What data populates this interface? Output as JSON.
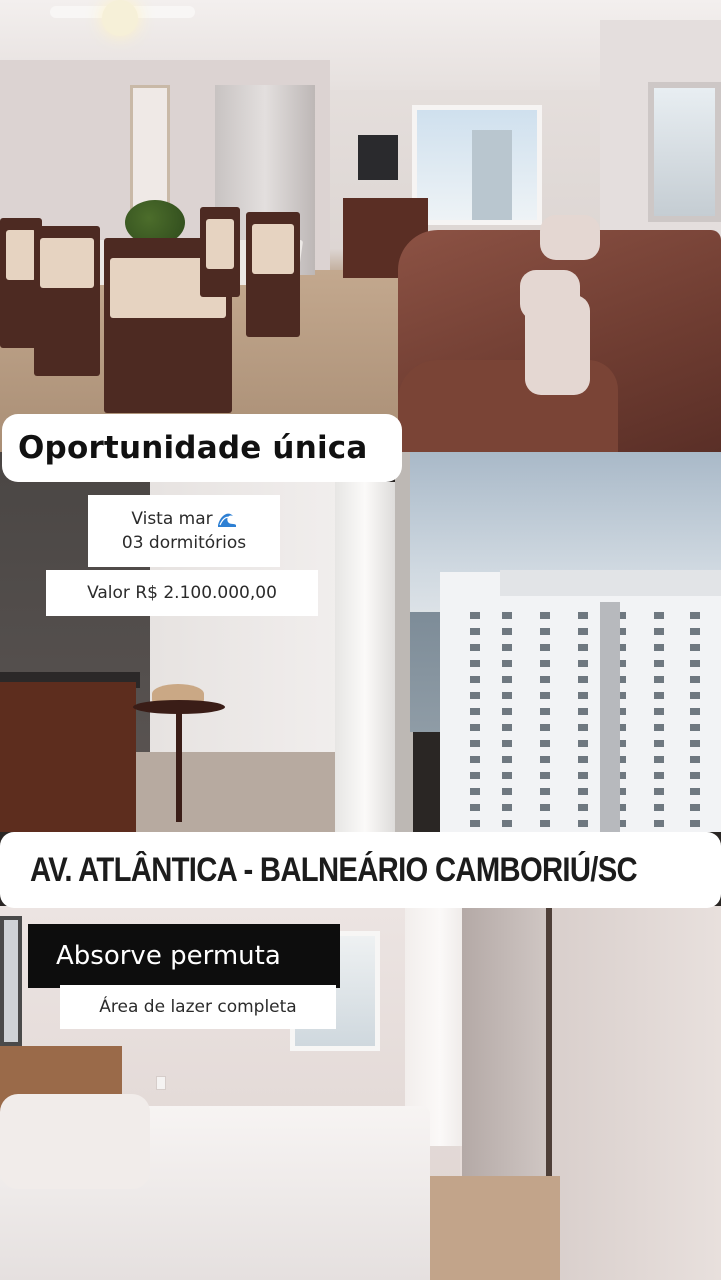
{
  "headline": "Oportunidade única",
  "features": {
    "sea_view": "Vista mar",
    "sea_view_icon": "wave-icon",
    "bedrooms": "03 dormitórios"
  },
  "price": "Valor R$ 2.100.000,00",
  "address": {
    "icon": "location-pin-icon",
    "text": "AV. ATLÂNTICA - BALNEÁRIO CAMBORIÚ/SC"
  },
  "trade": "Absorve permuta",
  "leisure": "Área de lazer completa",
  "colors": {
    "overlay_bg": "#ffffff",
    "dark_tag_bg": "#0d0d0d",
    "pin_gradient_start": "#f2386b",
    "pin_gradient_end": "#f7b733"
  }
}
